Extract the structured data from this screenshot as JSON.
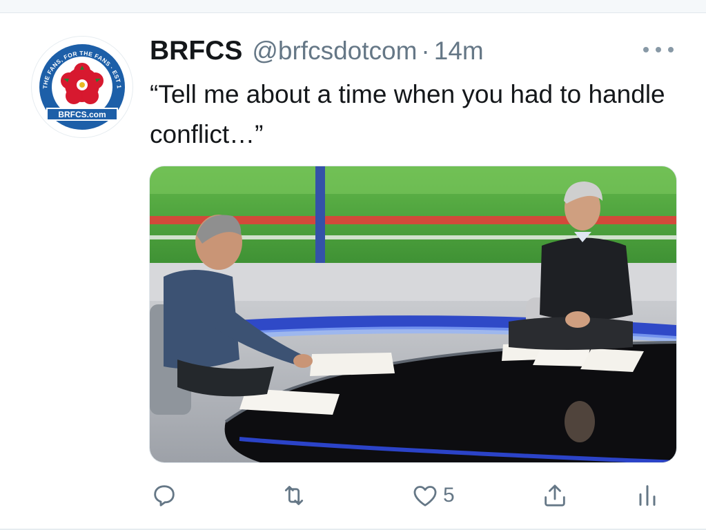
{
  "tweet": {
    "display_name": "BRFCS",
    "handle": "@brfcsdotcom",
    "separator": "·",
    "time": "14m",
    "text": "“Tell me about a time when you had to handle conflict…”"
  },
  "avatar": {
    "ring_text": "BY THE FANS, FOR THE FANS · EST 1996",
    "banner_text": "BRFCS.com"
  },
  "actions": {
    "reply_icon": "reply-icon",
    "retweet_icon": "retweet-icon",
    "like_icon": "heart-icon",
    "like_count": "5",
    "share_icon": "share-icon",
    "analytics_icon": "analytics-icon"
  },
  "colors": {
    "text": "#14171a",
    "secondary": "#657786",
    "logo_blue": "#1d5fa8",
    "logo_red": "#d7192f"
  }
}
